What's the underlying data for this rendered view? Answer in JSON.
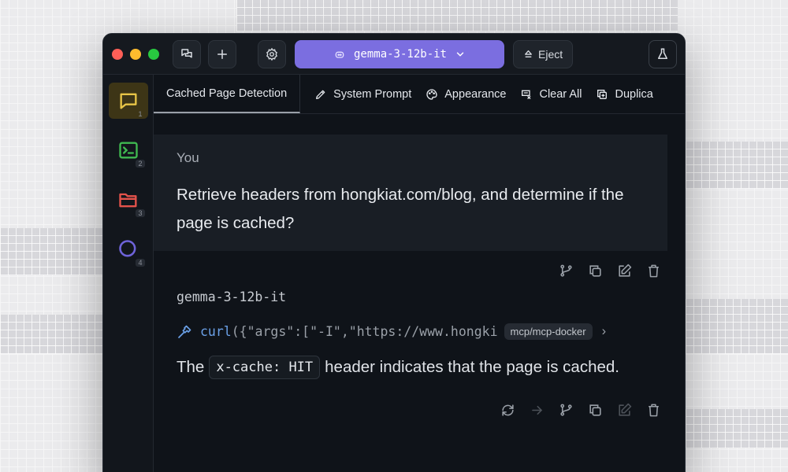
{
  "window": {
    "model_name": "gemma-3-12b-it",
    "eject_label": "Eject"
  },
  "sidebar": {
    "items": [
      {
        "num": "1",
        "icon": "chat-icon",
        "color": "#e8c547"
      },
      {
        "num": "2",
        "icon": "terminal-icon",
        "color": "#3fb950"
      },
      {
        "num": "3",
        "icon": "folder-icon",
        "color": "#e5534b"
      },
      {
        "num": "4",
        "icon": "search-icon",
        "color": "#6e63d9"
      }
    ]
  },
  "tabs": {
    "active": "Cached Page Detection",
    "tools": [
      {
        "label": "System Prompt",
        "icon": "pen-icon"
      },
      {
        "label": "Appearance",
        "icon": "palette-icon"
      },
      {
        "label": "Clear All",
        "icon": "clear-icon"
      },
      {
        "label": "Duplica",
        "icon": "duplicate-icon"
      }
    ]
  },
  "conversation": {
    "user_label": "You",
    "user_message": "Retrieve headers from hongkiat.com/blog, and determine if the page is cached?",
    "assistant_name": "gemma-3-12b-it",
    "tool_call": {
      "name": "curl",
      "args": "({\"args\":[\"-I\",\"https://www.hongki",
      "server": "mcp/mcp-docker"
    },
    "answer_prefix": "The",
    "answer_code": "x-cache: HIT",
    "answer_suffix": "header indicates that the page is cached."
  },
  "colors": {
    "accent": "#7b6ee0",
    "background": "#0f1319",
    "tool_name": "#6ba1e8"
  }
}
